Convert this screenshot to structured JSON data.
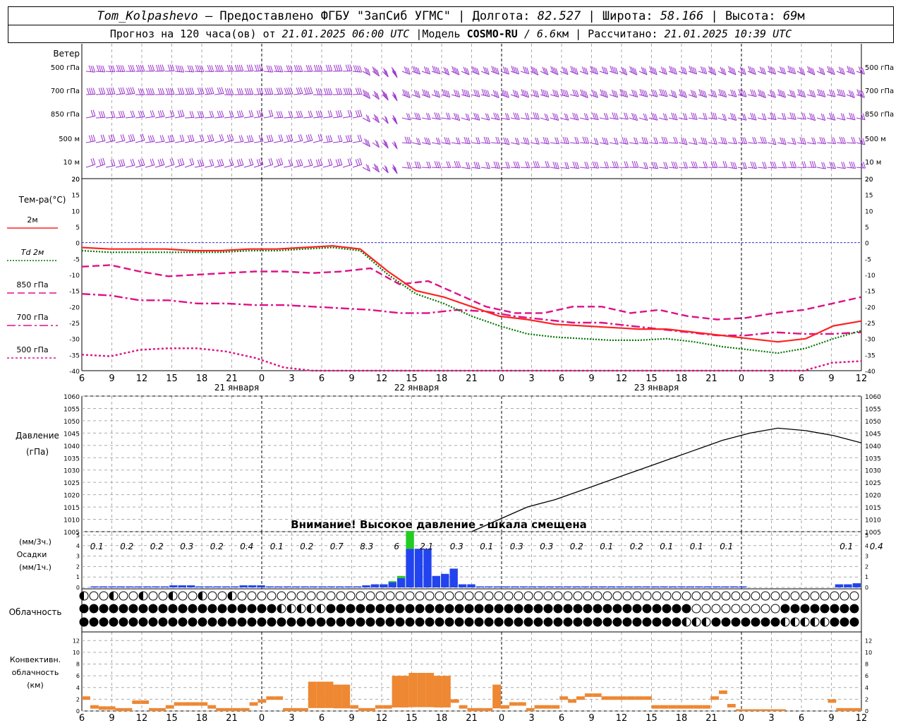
{
  "header": {
    "station": "Tom_Kolpashevo",
    "dash": " — ",
    "provider": "Предоставлено ФГБУ \"ЗапСиб УГМС\"",
    "sep": " | ",
    "lon_label": "Долгота: ",
    "lon": "82.527",
    "lat_label": "Широта: ",
    "lat": "58.166",
    "alt_label": "Высота: ",
    "alt": "69",
    "alt_unit": "м",
    "forecast_label": "Прогноз на 120 часа(ов) от ",
    "forecast_time": "21.01.2025 06:00 UTC",
    "model_label": "  |Модель ",
    "model": "COSMO-RU",
    "model_res": " / 6.6",
    "model_res_unit": "км",
    "calc_label": " | Рассчитано: ",
    "calc_time": "21.01.2025 10:39 UTC"
  },
  "panels": {
    "wind": {
      "title": "Ветер",
      "levels": [
        "500 гПа",
        "700 гПа",
        "850 гПа",
        "500  м",
        "10  м"
      ],
      "color": "#9933cc"
    },
    "temp": {
      "title": "Тем-ра(°C)",
      "legend": [
        {
          "label": "2м",
          "color": "#ff2222",
          "style": "solid"
        },
        {
          "label": "Td  2м",
          "color": "#007700",
          "style": "dotted"
        },
        {
          "label": "850 гПа",
          "color": "#dd1188",
          "style": "dash"
        },
        {
          "label": "700 гПа",
          "color": "#dd1188",
          "style": "dashdot"
        },
        {
          "label": "500 гПа",
          "color": "#dd1188",
          "style": "dot"
        }
      ],
      "zero_line_color": "#3333cc"
    },
    "pressure": {
      "title": "Давление",
      "unit": "(гПа)",
      "warning": "Внимание! Высокое давление - шкала смещена"
    },
    "precip": {
      "unit_3h": "(мм/3ч.)",
      "title": "Осадки",
      "unit_1h": "(мм/1ч.)",
      "totals": [
        "0.1",
        "0.2",
        "0.2",
        "0.3",
        "0.2",
        "0.4",
        "0.1",
        "0.2",
        "0.7",
        "8.3",
        "6",
        "2.1",
        "0.3",
        "0.1",
        "0.3",
        "0.3",
        "0.2",
        "0.1",
        "0.2",
        "0.1",
        "0.1",
        "0.1",
        "",
        "",
        "",
        "0.1",
        "0.4"
      ]
    },
    "clouds": {
      "title": "Облачность"
    },
    "convective": {
      "title_lines": [
        "Конвективн.",
        "облачность",
        "(км)"
      ],
      "color": "#ee8833"
    }
  },
  "x_axis": {
    "tick_labels": [
      "6",
      "9",
      "12",
      "15",
      "18",
      "21",
      "0",
      "3",
      "6",
      "9",
      "12",
      "15",
      "18",
      "21",
      "0",
      "3",
      "6",
      "9",
      "12",
      "15",
      "18",
      "21",
      "0",
      "3",
      "6",
      "9",
      "12"
    ],
    "day_labels": [
      "21 января",
      "22 января",
      "23 января"
    ]
  },
  "chart_data": [
    {
      "type": "line",
      "title": "Тем-ра(°C)",
      "x": [
        0,
        3,
        6,
        9,
        12,
        15,
        18,
        21,
        24,
        27,
        30,
        33,
        36,
        39,
        42,
        45,
        48,
        51,
        54,
        57,
        60,
        63,
        66,
        69,
        72,
        75,
        78
      ],
      "x_unit": "hours from 21.01.2025 06:00 UTC",
      "ylim": [
        -40,
        20
      ],
      "yticks": [
        20,
        15,
        10,
        5,
        0,
        -5,
        -10,
        -15,
        -20,
        -25,
        -30,
        -35,
        -40
      ],
      "series": [
        {
          "name": "2м",
          "values": [
            -1.5,
            -2,
            -2,
            -2,
            -2.5,
            -2.5,
            -2,
            -2,
            -1.5,
            -1,
            -2,
            -9,
            -15,
            -17,
            -20,
            -23,
            -24,
            -25.5,
            -26,
            -26.5,
            -27,
            -27,
            -28,
            -29,
            -30,
            -31,
            -30,
            -26,
            -24.5
          ]
        },
        {
          "name": "Td  2м",
          "values": [
            -2.5,
            -3,
            -3,
            -3,
            -3,
            -3,
            -2.5,
            -2.5,
            -2,
            -1.5,
            -2.5,
            -10,
            -16,
            -19,
            -23,
            -26,
            -28.5,
            -29.5,
            -30,
            -30.5,
            -30.5,
            -30,
            -31,
            -32.5,
            -33.5,
            -34.5,
            -33,
            -30,
            -27.5
          ]
        },
        {
          "name": "850 гПа",
          "values": [
            -7.5,
            -7,
            -9,
            -10.5,
            -10,
            -9.5,
            -9,
            -9,
            -9.5,
            -9,
            -8,
            -13,
            -12,
            -16,
            -20,
            -22,
            -22,
            -20,
            -20,
            -22,
            -21,
            -23,
            -24,
            -23.5,
            -22,
            -21,
            -19,
            -17
          ]
        },
        {
          "name": "700 гПа",
          "values": [
            -16,
            -16.5,
            -18,
            -18,
            -19,
            -19,
            -19.5,
            -19.5,
            -20,
            -20.5,
            -21,
            -22,
            -22,
            -21,
            -21.5,
            -23,
            -24,
            -25,
            -25,
            -26,
            -27,
            -28,
            -29,
            -29,
            -28,
            -28.5,
            -28.5,
            -28
          ]
        },
        {
          "name": "500 гПа",
          "values": [
            -35,
            -35.5,
            -33.5,
            -33,
            -33,
            -34,
            -36,
            -39,
            -41,
            -42,
            -43,
            -44,
            -45,
            -45,
            -45,
            -45,
            -45,
            -45,
            -44,
            -43,
            -42,
            -43,
            -44,
            -43,
            -42,
            -40,
            -37.5,
            -37
          ]
        }
      ]
    },
    {
      "type": "line",
      "title": "Давление",
      "ylabel": "(гПа)",
      "x": [
        39,
        42,
        45,
        48,
        51,
        54,
        57,
        60,
        63,
        66,
        69,
        72,
        75,
        78
      ],
      "ylim": [
        1005,
        1060
      ],
      "yticks": [
        1060,
        1055,
        1050,
        1045,
        1040,
        1035,
        1030,
        1025,
        1020,
        1015,
        1010,
        1005
      ],
      "series": [
        {
          "name": "",
          "values": [
            1005,
            1010,
            1015,
            1018,
            1022,
            1026,
            1030,
            1034,
            1038,
            1042,
            1045,
            1047,
            1046,
            1044,
            1041
          ]
        }
      ]
    },
    {
      "type": "bar",
      "title": "Осадки",
      "ylim": [
        0,
        5
      ],
      "yticks": [
        5,
        4,
        3,
        2,
        1,
        0
      ],
      "series": [
        {
          "name": "(мм/1ч.)",
          "values": [
            0,
            0.1,
            0.1,
            0.1,
            0.1,
            0.1,
            0.1,
            0.1,
            0.1,
            0.1,
            0.2,
            0.2,
            0.2,
            0.1,
            0.1,
            0.1,
            0.1,
            0.1,
            0.2,
            0.2,
            0.2,
            0.1,
            0.1,
            0.1,
            0.1,
            0.1,
            0.1,
            0.1,
            0.1,
            0.1,
            0.1,
            0.1,
            0.2,
            0.3,
            0.3,
            0.5,
            0.9,
            3.7,
            3.7,
            3.7,
            1.1,
            1.3,
            1.8,
            0.3,
            0.3,
            0.1,
            0.1,
            0.1,
            0.1,
            0.1,
            0.1,
            0.1,
            0.1,
            0.1,
            0.1,
            0.1,
            0.1,
            0.1,
            0.1,
            0.1,
            0.1,
            0.1,
            0.1,
            0.1,
            0.1,
            0.1,
            0.1,
            0.1,
            0.1,
            0.1,
            0.1,
            0.1,
            0.1,
            0.1,
            0.1,
            0.1,
            0,
            0,
            0,
            0,
            0,
            0,
            0,
            0,
            0,
            0,
            0.3,
            0.3,
            0.4
          ]
        },
        {
          "name": "snow",
          "values": [
            0,
            0,
            0,
            0,
            0,
            0,
            0,
            0,
            0,
            0,
            0,
            0,
            0,
            0,
            0,
            0,
            0,
            0,
            0,
            0,
            0,
            0,
            0,
            0,
            0,
            0,
            0,
            0,
            0,
            0,
            0,
            0,
            0,
            0,
            0,
            0.1,
            0.2,
            1.7,
            0,
            0,
            0,
            0,
            0,
            0,
            0,
            0,
            0,
            0,
            0,
            0,
            0,
            0,
            0,
            0,
            0,
            0,
            0,
            0,
            0,
            0,
            0,
            0,
            0,
            0,
            0,
            0,
            0,
            0,
            0,
            0,
            0,
            0,
            0,
            0,
            0,
            0,
            0,
            0,
            0,
            0,
            0,
            0,
            0,
            0,
            0,
            0,
            0,
            0,
            0,
            0,
            0
          ]
        }
      ]
    },
    {
      "type": "bar",
      "title": "Конвективн. облачность",
      "ylabel": "(км)",
      "ylim": [
        0,
        13
      ],
      "yticks": [
        12,
        10,
        8,
        6,
        4,
        2,
        0
      ],
      "series": [
        {
          "name": "",
          "values": [
            2.5,
            1,
            0.8,
            0.8,
            0.5,
            0.5,
            1.8,
            1.8,
            0.5,
            0.5,
            1,
            1.5,
            1.5,
            1.5,
            1.5,
            1,
            0.5,
            0.5,
            0.5,
            0.5,
            1.5,
            2,
            2.5,
            2.5,
            0.5,
            0.5,
            0.5,
            5,
            5,
            5,
            4.5,
            4.5,
            1,
            0.5,
            0.5,
            1,
            1,
            6,
            6,
            6.5,
            6.5,
            6.5,
            6,
            6,
            2,
            1,
            0.5,
            0.5,
            0.5,
            4.5,
            1,
            1.5,
            1.5,
            0.5,
            1,
            1,
            1,
            2.5,
            2,
            2.5,
            3,
            3,
            2.5,
            2.5,
            2.5,
            2.5,
            2.5,
            2.5,
            1,
            1,
            1,
            1,
            1,
            1,
            1,
            2.5,
            3.5,
            1.2,
            0.3,
            0.3,
            0.3,
            0.3,
            0.3,
            0.3,
            0,
            0,
            0,
            0,
            0,
            2,
            0.5,
            0.5,
            0.5
          ]
        }
      ]
    }
  ]
}
